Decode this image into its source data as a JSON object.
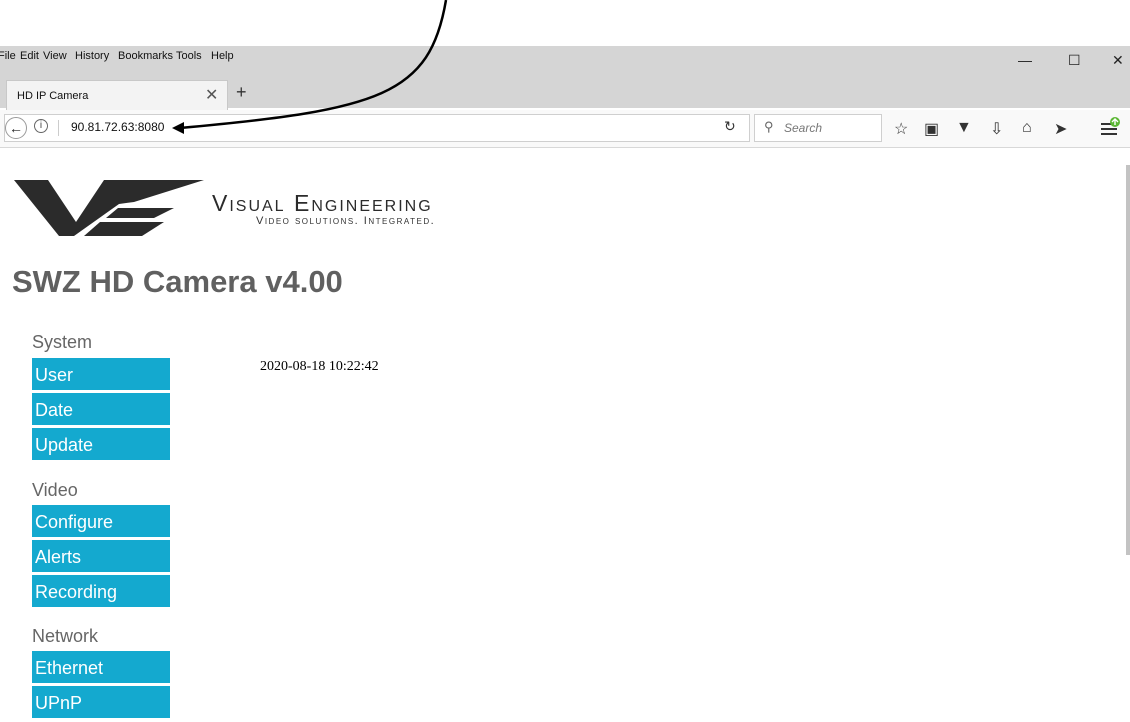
{
  "menu": [
    "File",
    "Edit",
    "View",
    "History",
    "Bookmarks",
    "Tools",
    "Help"
  ],
  "window_controls": {
    "minimize": "—",
    "maximize": "☐",
    "close": "✕"
  },
  "tab": {
    "title": "HD IP Camera",
    "close": "✕",
    "new": "+"
  },
  "address": {
    "url": "90.81.72.63:8080"
  },
  "search": {
    "placeholder": "Search"
  },
  "brand": {
    "name": "Visual Engineering",
    "tagline": "Video solutions. Integrated."
  },
  "page": {
    "title": "SWZ HD Camera v4.00",
    "datetime": "2020-08-18 10:22:42"
  },
  "nav": {
    "system": {
      "label": "System",
      "items": [
        "User",
        "Date",
        "Update"
      ]
    },
    "video": {
      "label": "Video",
      "items": [
        "Configure",
        "Alerts",
        "Recording"
      ]
    },
    "network": {
      "label": "Network",
      "items": [
        "Ethernet",
        "UPnP"
      ]
    }
  },
  "colors": {
    "nav_button": "#14a9cf",
    "title": "#606060",
    "logo": "#2b2b2b"
  }
}
